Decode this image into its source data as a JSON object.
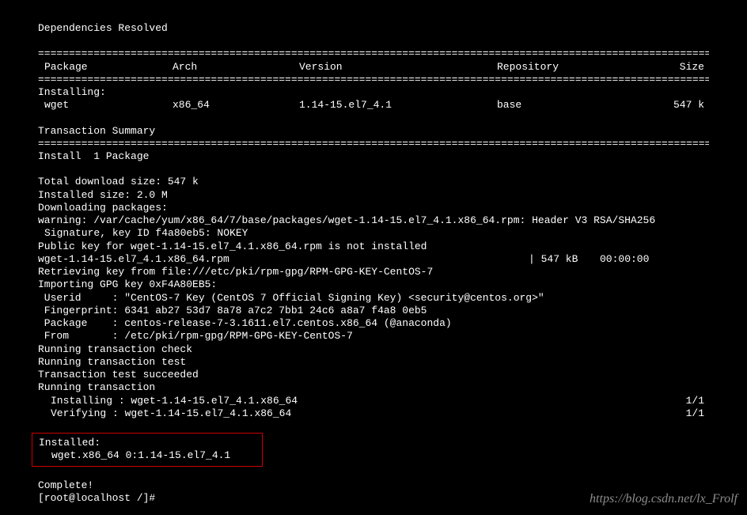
{
  "title": "Dependencies Resolved",
  "divider_double": "================================================================================================================",
  "columns": {
    "package": "Package",
    "arch": "Arch",
    "version": "Version",
    "repository": "Repository",
    "size": "Size"
  },
  "installing_label": "Installing:",
  "packages": [
    {
      "name": "wget",
      "arch": "x86_64",
      "version": "1.14-15.el7_4.1",
      "repo": "base",
      "size": "547 k"
    }
  ],
  "transaction_summary": "Transaction Summary",
  "install_count": "Install  1 Package",
  "total_download": "Total download size: 547 k",
  "installed_size": "Installed size: 2.0 M",
  "downloading": "Downloading packages:",
  "warning_line1": "warning: /var/cache/yum/x86_64/7/base/packages/wget-1.14-15.el7_4.1.x86_64.rpm: Header V3 RSA/SHA256",
  "warning_line2": "Signature, key ID f4a80eb5: NOKEY",
  "pubkey": "Public key for wget-1.14-15.el7_4.1.x86_64.rpm is not installed",
  "dl_file": "wget-1.14-15.el7_4.1.x86_64.rpm",
  "dl_size": "| 547 kB",
  "dl_time": "00:00:00",
  "retrieving": "Retrieving key from file:///etc/pki/rpm-gpg/RPM-GPG-KEY-CentOS-7",
  "importing": "Importing GPG key 0xF4A80EB5:",
  "userid": " Userid     : \"CentOS-7 Key (CentOS 7 Official Signing Key) <security@centos.org>\"",
  "fingerprint": " Fingerprint: 6341 ab27 53d7 8a78 a7c2 7bb1 24c6 a8a7 f4a8 0eb5",
  "package_origin": " Package    : centos-release-7-3.1611.el7.centos.x86_64 (@anaconda)",
  "from": " From       : /etc/pki/rpm-gpg/RPM-GPG-KEY-CentOS-7",
  "txn_check": "Running transaction check",
  "txn_test": "Running transaction test",
  "txn_succeed": "Transaction test succeeded",
  "txn_run": "Running transaction",
  "installing_step": "Installing : wget-1.14-15.el7_4.1.x86_64",
  "installing_progress": "1/1",
  "verifying_step": "Verifying  : wget-1.14-15.el7_4.1.x86_64",
  "verifying_progress": "1/1",
  "installed_header": "Installed:",
  "installed_item": "wget.x86_64 0:1.14-15.el7_4.1",
  "complete": "Complete!",
  "prompt": "[root@localhost /]#",
  "watermark": "https://blog.csdn.net/lx_Frolf"
}
